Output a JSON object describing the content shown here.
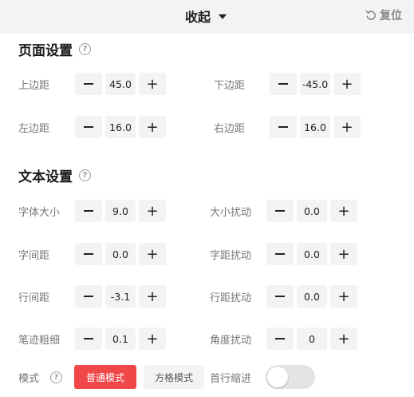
{
  "header": {
    "collapse_label": "收起",
    "reset_label": "复位"
  },
  "page_settings": {
    "title": "页面设置",
    "top_margin": {
      "label": "上边距",
      "value": "45.0"
    },
    "bottom_margin": {
      "label": "下边距",
      "value": "-45.0"
    },
    "left_margin": {
      "label": "左边距",
      "value": "16.0"
    },
    "right_margin": {
      "label": "右边距",
      "value": "16.0"
    }
  },
  "text_settings": {
    "title": "文本设置",
    "font_size": {
      "label": "字体大小",
      "value": "9.0"
    },
    "size_jitter": {
      "label": "大小扰动",
      "value": "0.0"
    },
    "char_spacing": {
      "label": "字间距",
      "value": "0.0"
    },
    "char_spacing_jitter": {
      "label": "字距扰动",
      "value": "0.0"
    },
    "line_spacing": {
      "label": "行间距",
      "value": "-3.1"
    },
    "line_spacing_jitter": {
      "label": "行距扰动",
      "value": "0.0"
    },
    "stroke_width": {
      "label": "笔迹粗细",
      "value": "0.1"
    },
    "angle_jitter": {
      "label": "角度扰动",
      "value": "0"
    }
  },
  "mode": {
    "label": "模式",
    "options": [
      "普通模式",
      "方格模式"
    ],
    "selected": "普通模式",
    "first_line_indent": {
      "label": "首行缩进",
      "enabled": false
    }
  },
  "colors": {
    "accent": "#f04848",
    "control_bg": "#f3f3f3",
    "toggle_off": "#e4e4e4"
  }
}
